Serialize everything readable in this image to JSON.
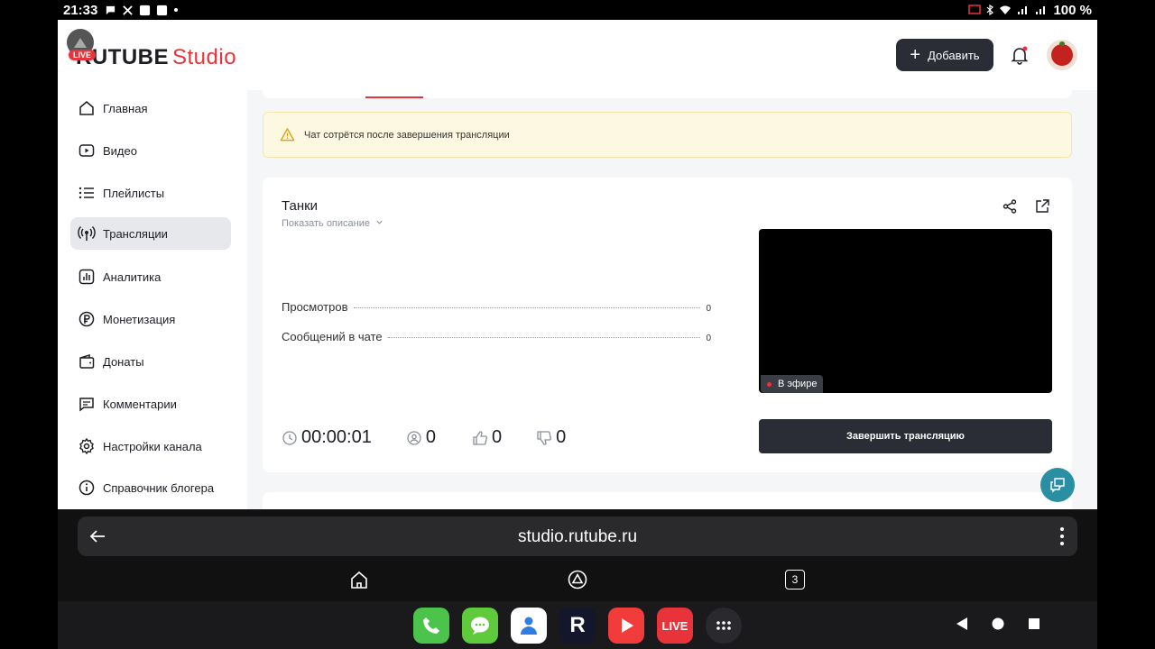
{
  "status_bar": {
    "time": "21:33",
    "battery": "100 %"
  },
  "header": {
    "logo_main": "RUTUBE",
    "logo_studio": "Studio",
    "live_tag": "LIVE",
    "add_label": "Добавить"
  },
  "sidebar": {
    "items": [
      {
        "label": "Главная",
        "icon": "home-icon"
      },
      {
        "label": "Видео",
        "icon": "video-icon"
      },
      {
        "label": "Плейлисты",
        "icon": "playlist-icon"
      },
      {
        "label": "Трансляции",
        "icon": "broadcast-icon",
        "active": true
      },
      {
        "label": "Аналитика",
        "icon": "analytics-icon"
      },
      {
        "label": "Монетизация",
        "icon": "ruble-icon"
      },
      {
        "label": "Донаты",
        "icon": "wallet-icon"
      },
      {
        "label": "Комментарии",
        "icon": "comment-icon"
      },
      {
        "label": "Настройки канала",
        "icon": "gear-icon"
      },
      {
        "label": "Справочник блогера",
        "icon": "info-icon"
      }
    ]
  },
  "warning": {
    "text": "Чат сотрётся после завершения трансляции"
  },
  "stream_card": {
    "title": "Танки",
    "show_description": "Показать описание",
    "stats": [
      {
        "label": "Просмотров",
        "value": "0"
      },
      {
        "label": "Сообщений в чате",
        "value": "0"
      }
    ],
    "duration": "00:00:01",
    "viewers": "0",
    "likes": "0",
    "dislikes": "0",
    "on_air_label": "В эфире",
    "end_button": "Завершить трансляцию"
  },
  "browser": {
    "url": "studio.rutube.ru",
    "tab_count": "3"
  },
  "dock": {
    "rutube_letter": "R",
    "live_label": "LIVE"
  },
  "colors": {
    "accent_red": "#e8333a",
    "dark_button": "#2a2d35",
    "warning_bg": "#fdf8e1",
    "help_fab": "#2a8fa3"
  }
}
